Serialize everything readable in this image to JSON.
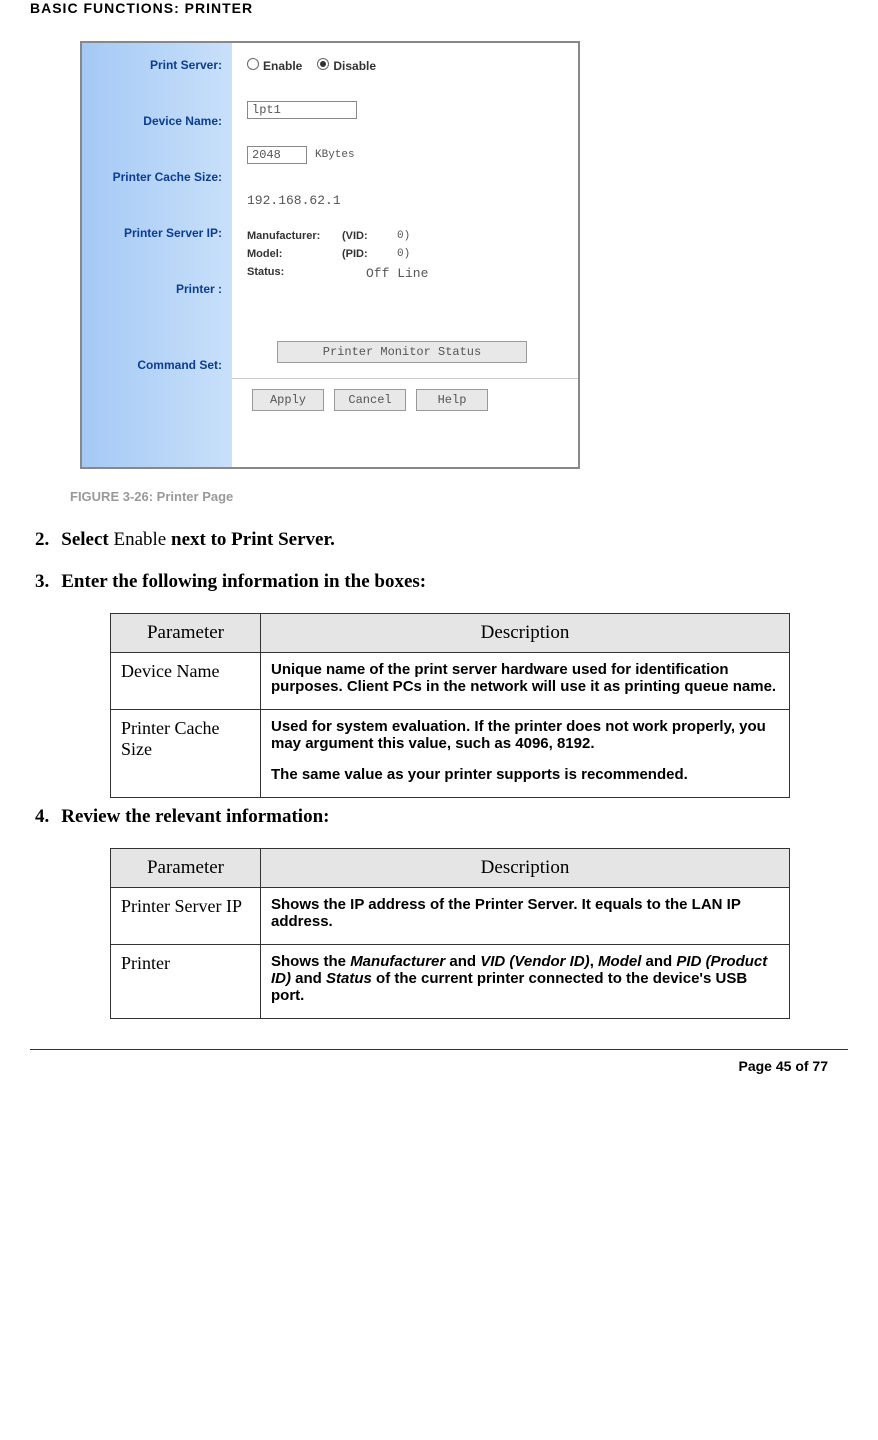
{
  "header": "BASIC FUNCTIONS: PRINTER",
  "sidebar": {
    "print_server": "Print Server:",
    "device_name": "Device Name:",
    "cache_size": "Printer Cache Size:",
    "server_ip": "Printer Server IP:",
    "printer": "Printer :",
    "command_set": "Command Set:"
  },
  "form": {
    "enable": "Enable",
    "disable": "Disable",
    "device_value": "lpt1",
    "cache_value": "2048",
    "kbytes": "KBytes",
    "ip": "192.168.62.1",
    "mfr_label": "Manufacturer:",
    "vid_label": "(VID:",
    "vid_val": "0)",
    "model_label": "Model:",
    "pid_label": "(PID:",
    "pid_val": "0)",
    "status_label": "Status:",
    "status_val": "Off Line",
    "monitor_btn": "Printer Monitor Status",
    "apply": "Apply",
    "cancel": "Cancel",
    "help": "Help"
  },
  "figure": "FIGURE 3-26: Printer Page",
  "step2": {
    "num": "2.",
    "select": "Select ",
    "enable": "Enable ",
    "rest": "next to Print Server."
  },
  "step3": {
    "num": "3.",
    "text": "Enter the following information in the boxes:"
  },
  "table1": {
    "th1": "Parameter",
    "th2": "Description",
    "r1c1": "Device Name",
    "r1c2": "Unique name of the print server hardware used for identification purposes. Client PCs in the network will use it as printing queue name.",
    "r2c1": "Printer Cache Size",
    "r2c2a": "Used for system evaluation. If the printer does not work properly, you may argument this value, such as 4096, 8192.",
    "r2c2b": "The same value as your printer supports is recommended."
  },
  "step4": {
    "num": "4.",
    "text": "Review the relevant information:"
  },
  "table2": {
    "th1": "Parameter",
    "th2": "Description",
    "r1c1": "Printer Server IP",
    "r1c2": "Shows the IP address of the Printer Server. It equals to the LAN IP address.",
    "r2c1": "Printer",
    "r2c2_pre": "Shows the ",
    "r2c2_mfr": "Manufacturer",
    "r2c2_and1": " and ",
    "r2c2_vid": "VID (Vendor ID)",
    "r2c2_comma": ", ",
    "r2c2_model": "Model",
    "r2c2_and2": " and ",
    "r2c2_pid": "PID (Product ID)",
    "r2c2_and3": " and ",
    "r2c2_status": "Status",
    "r2c2_post": " of the current printer connected to the device's USB port."
  },
  "footer": "Page 45 of 77"
}
